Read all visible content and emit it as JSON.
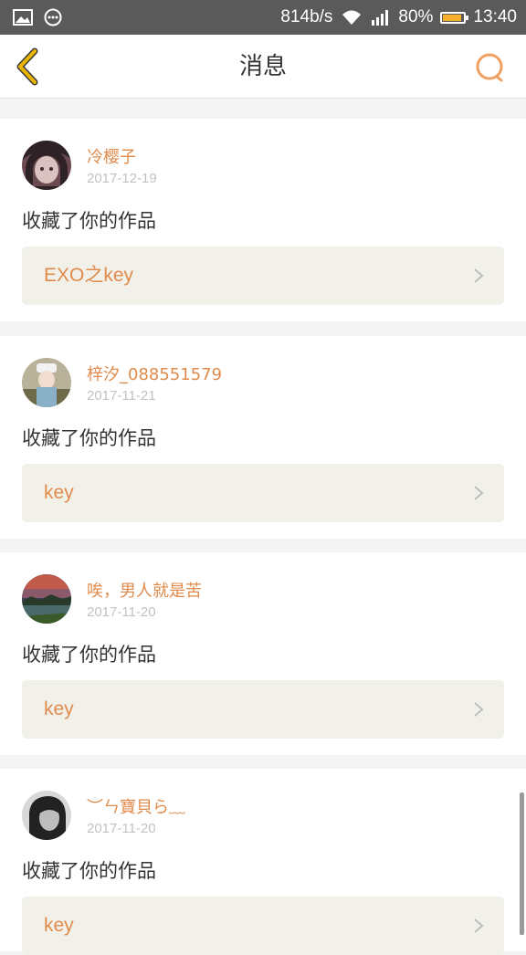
{
  "status_bar": {
    "net_speed": "814b/s",
    "battery_percent": "80%",
    "battery_level": 0.8,
    "time": "13:40",
    "icons": [
      "image-icon",
      "message-icon",
      "wifi-icon",
      "signal-icon",
      "battery-icon"
    ]
  },
  "header": {
    "title": "消息",
    "back_icon": "chevron-left-icon",
    "search_icon": "search-icon",
    "accent_color": "#f0a060",
    "back_color": "#e9b400"
  },
  "notifications": [
    {
      "name": "冷樱子",
      "date": "2017-12-19",
      "action": "收藏了你的作品",
      "work_title": "EXO之key"
    },
    {
      "name": "梓汐_088551579",
      "date": "2017-11-21",
      "action": "收藏了你的作品",
      "work_title": "key"
    },
    {
      "name": "唉，男人就是苦",
      "date": "2017-11-20",
      "action": "收藏了你的作品",
      "work_title": "key"
    },
    {
      "name": "︶ㄣ寶貝ら﹏",
      "date": "2017-11-20",
      "action": "收藏了你的作品",
      "work_title": "key"
    }
  ],
  "colors": {
    "name_color": "#e08b4c",
    "date_color": "#c2c2c2",
    "work_bg": "#f2f1e9"
  }
}
